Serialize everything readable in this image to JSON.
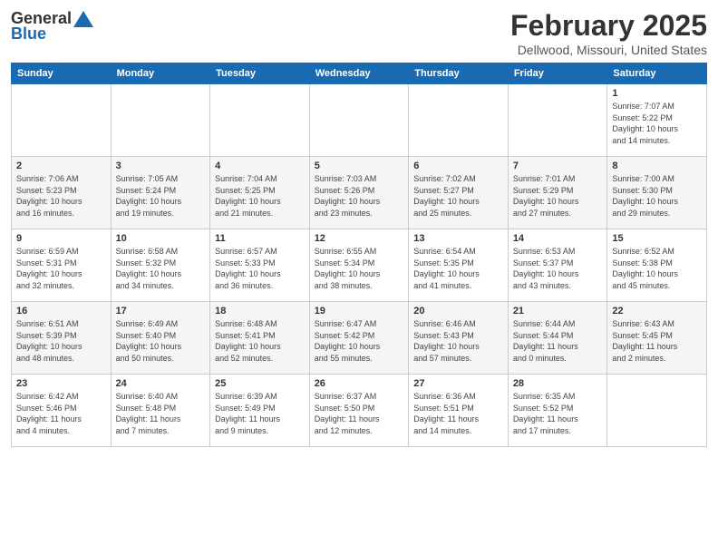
{
  "header": {
    "logo_general": "General",
    "logo_blue": "Blue",
    "title": "February 2025",
    "subtitle": "Dellwood, Missouri, United States"
  },
  "calendar": {
    "days_of_week": [
      "Sunday",
      "Monday",
      "Tuesday",
      "Wednesday",
      "Thursday",
      "Friday",
      "Saturday"
    ],
    "weeks": [
      [
        {
          "day": "",
          "info": ""
        },
        {
          "day": "",
          "info": ""
        },
        {
          "day": "",
          "info": ""
        },
        {
          "day": "",
          "info": ""
        },
        {
          "day": "",
          "info": ""
        },
        {
          "day": "",
          "info": ""
        },
        {
          "day": "1",
          "info": "Sunrise: 7:07 AM\nSunset: 5:22 PM\nDaylight: 10 hours\nand 14 minutes."
        }
      ],
      [
        {
          "day": "2",
          "info": "Sunrise: 7:06 AM\nSunset: 5:23 PM\nDaylight: 10 hours\nand 16 minutes."
        },
        {
          "day": "3",
          "info": "Sunrise: 7:05 AM\nSunset: 5:24 PM\nDaylight: 10 hours\nand 19 minutes."
        },
        {
          "day": "4",
          "info": "Sunrise: 7:04 AM\nSunset: 5:25 PM\nDaylight: 10 hours\nand 21 minutes."
        },
        {
          "day": "5",
          "info": "Sunrise: 7:03 AM\nSunset: 5:26 PM\nDaylight: 10 hours\nand 23 minutes."
        },
        {
          "day": "6",
          "info": "Sunrise: 7:02 AM\nSunset: 5:27 PM\nDaylight: 10 hours\nand 25 minutes."
        },
        {
          "day": "7",
          "info": "Sunrise: 7:01 AM\nSunset: 5:29 PM\nDaylight: 10 hours\nand 27 minutes."
        },
        {
          "day": "8",
          "info": "Sunrise: 7:00 AM\nSunset: 5:30 PM\nDaylight: 10 hours\nand 29 minutes."
        }
      ],
      [
        {
          "day": "9",
          "info": "Sunrise: 6:59 AM\nSunset: 5:31 PM\nDaylight: 10 hours\nand 32 minutes."
        },
        {
          "day": "10",
          "info": "Sunrise: 6:58 AM\nSunset: 5:32 PM\nDaylight: 10 hours\nand 34 minutes."
        },
        {
          "day": "11",
          "info": "Sunrise: 6:57 AM\nSunset: 5:33 PM\nDaylight: 10 hours\nand 36 minutes."
        },
        {
          "day": "12",
          "info": "Sunrise: 6:55 AM\nSunset: 5:34 PM\nDaylight: 10 hours\nand 38 minutes."
        },
        {
          "day": "13",
          "info": "Sunrise: 6:54 AM\nSunset: 5:35 PM\nDaylight: 10 hours\nand 41 minutes."
        },
        {
          "day": "14",
          "info": "Sunrise: 6:53 AM\nSunset: 5:37 PM\nDaylight: 10 hours\nand 43 minutes."
        },
        {
          "day": "15",
          "info": "Sunrise: 6:52 AM\nSunset: 5:38 PM\nDaylight: 10 hours\nand 45 minutes."
        }
      ],
      [
        {
          "day": "16",
          "info": "Sunrise: 6:51 AM\nSunset: 5:39 PM\nDaylight: 10 hours\nand 48 minutes."
        },
        {
          "day": "17",
          "info": "Sunrise: 6:49 AM\nSunset: 5:40 PM\nDaylight: 10 hours\nand 50 minutes."
        },
        {
          "day": "18",
          "info": "Sunrise: 6:48 AM\nSunset: 5:41 PM\nDaylight: 10 hours\nand 52 minutes."
        },
        {
          "day": "19",
          "info": "Sunrise: 6:47 AM\nSunset: 5:42 PM\nDaylight: 10 hours\nand 55 minutes."
        },
        {
          "day": "20",
          "info": "Sunrise: 6:46 AM\nSunset: 5:43 PM\nDaylight: 10 hours\nand 57 minutes."
        },
        {
          "day": "21",
          "info": "Sunrise: 6:44 AM\nSunset: 5:44 PM\nDaylight: 11 hours\nand 0 minutes."
        },
        {
          "day": "22",
          "info": "Sunrise: 6:43 AM\nSunset: 5:45 PM\nDaylight: 11 hours\nand 2 minutes."
        }
      ],
      [
        {
          "day": "23",
          "info": "Sunrise: 6:42 AM\nSunset: 5:46 PM\nDaylight: 11 hours\nand 4 minutes."
        },
        {
          "day": "24",
          "info": "Sunrise: 6:40 AM\nSunset: 5:48 PM\nDaylight: 11 hours\nand 7 minutes."
        },
        {
          "day": "25",
          "info": "Sunrise: 6:39 AM\nSunset: 5:49 PM\nDaylight: 11 hours\nand 9 minutes."
        },
        {
          "day": "26",
          "info": "Sunrise: 6:37 AM\nSunset: 5:50 PM\nDaylight: 11 hours\nand 12 minutes."
        },
        {
          "day": "27",
          "info": "Sunrise: 6:36 AM\nSunset: 5:51 PM\nDaylight: 11 hours\nand 14 minutes."
        },
        {
          "day": "28",
          "info": "Sunrise: 6:35 AM\nSunset: 5:52 PM\nDaylight: 11 hours\nand 17 minutes."
        },
        {
          "day": "",
          "info": ""
        }
      ]
    ]
  }
}
